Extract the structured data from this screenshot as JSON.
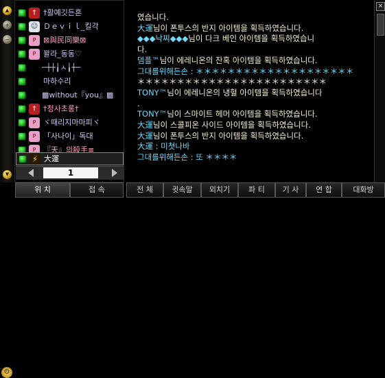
{
  "friends": [
    {
      "name": "†활예깃든혼",
      "avatar_char": "†"
    },
    {
      "name": "Ｄｅｖｉｌ_킬각",
      "avatar_char": "☺"
    },
    {
      "name": "⊠與民同樂⊠",
      "avatar_char": "P"
    },
    {
      "name": "꽐라_동동♡",
      "avatar_char": "P"
    },
    {
      "name": "─┼┼╽ㅅ╽┼─",
      "avatar_char": ""
    },
    {
      "name": "마하수리",
      "avatar_char": ""
    },
    {
      "name": "▩without『you』▩",
      "avatar_char": ""
    },
    {
      "name": "†청사초롱†",
      "avatar_char": "†"
    },
    {
      "name": "ヾ때리지마마피ヾ",
      "avatar_char": "P"
    },
    {
      "name": "「사나이」독대",
      "avatar_char": "P"
    },
    {
      "name": "『天』의殺手≡",
      "avatar_char": "P"
    },
    {
      "name": "大運",
      "avatar_char": "⚡"
    }
  ],
  "pager": {
    "page": "1"
  },
  "chat": [
    {
      "speaker": "",
      "text": "였습니다."
    },
    {
      "speaker": "大運",
      "text": "님이 폰투스의 반지 아이템을 획득하였습니다."
    },
    {
      "speaker": "◆◆◆낙찌◆◆◆",
      "text": "님이 다크 베인 아이템을 획득하였습니"
    },
    {
      "speaker": "",
      "text": "다."
    },
    {
      "speaker": "뎀플™",
      "text": "님이 에레니온의 잔혹 아이템을 획득하였습니다."
    },
    {
      "speaker": "그대를위해든손",
      "text": " : ＊＊＊＊＊＊＊＊＊＊＊＊＊＊＊＊＊＊＊＊"
    },
    {
      "speaker": "",
      "text": "＊＊＊＊＊＊＊＊＊＊＊＊＊＊＊＊＊＊＊＊＊＊＊＊"
    },
    {
      "speaker": "TONY™",
      "text": "님이 에레니온의 냉혈 아이템을 획득하였습니다"
    },
    {
      "speaker": "",
      "text": "."
    },
    {
      "speaker": "TONY™",
      "text": "님이 스마이트 헤머 아이템을 획득하였습니다."
    },
    {
      "speaker": "大運",
      "text": "님이 스콜피온 사이드 아이템을 획득하였습니다."
    },
    {
      "speaker": "大運",
      "text": "님이 폰투스의 반지 아이템을 획득하였습니다."
    },
    {
      "speaker": "大運",
      "text": " : 미쳣나바"
    },
    {
      "speaker": "그대를위해든손",
      "text": " : 또 ＊＊＊＊"
    }
  ],
  "tabs": [
    {
      "label": "위 치"
    },
    {
      "label": "접 속"
    },
    {
      "label": "전 체"
    },
    {
      "label": "귓속말"
    },
    {
      "label": "외치기"
    },
    {
      "label": "파 티"
    },
    {
      "label": "기 사"
    },
    {
      "label": "연 합"
    },
    {
      "label": "대화방"
    }
  ]
}
